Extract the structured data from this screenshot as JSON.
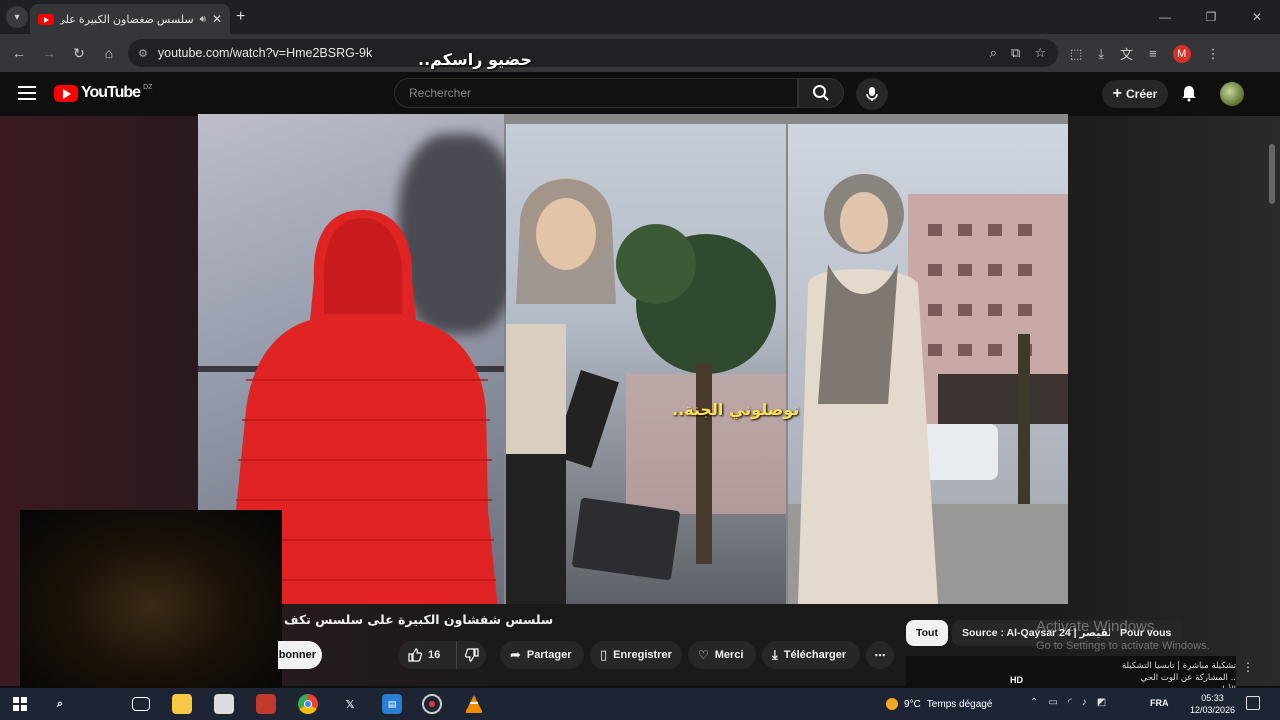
{
  "browser": {
    "tab_title": "سلسس ضغضاون الكبيرة على",
    "tab_close": "✕",
    "new_tab": "+",
    "url": "youtube.com/watch?v=Hme2BSRG-9k",
    "window_controls": [
      "—",
      "❐",
      "✕"
    ]
  },
  "youtube": {
    "logo_text": "YouTube",
    "country_code": "DZ",
    "search_placeholder": "Rechercher",
    "create_label": "Créer"
  },
  "video": {
    "overlay_text_1": "حضيو راسكم..",
    "overlay_text_2": "توصلوني الجنة..",
    "title": "سلسس شفشاون الكبيرة على سلسس تكف"
  },
  "actions": {
    "subscribe_label": "Abonner",
    "like_count": "16",
    "share": "Partager",
    "save": "Enregistrer",
    "thanks": "Merci",
    "download": "Télécharger",
    "more": "⋯"
  },
  "chips": {
    "all": "Tout",
    "source": "Source : Al-Qaysar 24 | القيصر",
    "for_you": "Pour vous"
  },
  "watermark": {
    "line1": "Activate Windows",
    "line2": "Go to Settings to activate Windows."
  },
  "suggestion": {
    "text": "تشكيلة مباشرة | تابسيا التشكيلة .. المشاركة عن الوت الحي الأولى",
    "hd": "HD"
  },
  "taskbar": {
    "weather": "9°C",
    "weather_desc": "Temps dégagé",
    "lang": "FRA",
    "time": "05:33",
    "date": "12/03/2026",
    "colors": {
      "chrome": "#4285f4",
      "x": "#000000",
      "vlc": "#f08c00"
    }
  }
}
